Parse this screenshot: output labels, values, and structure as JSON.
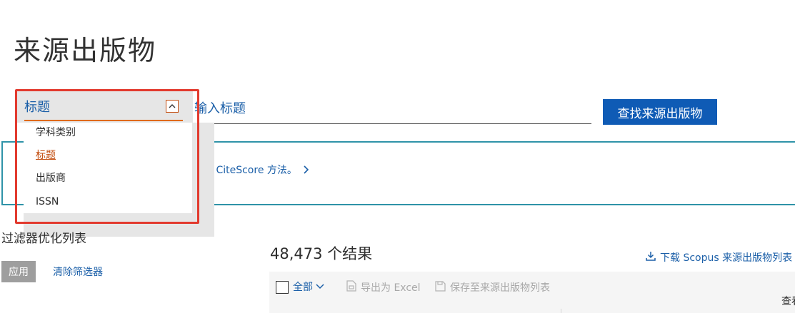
{
  "page": {
    "title": "来源出版物"
  },
  "search": {
    "field_selected": "标题",
    "placeholder": "输入标题",
    "button_label": "查找来源出版物",
    "field_options": [
      {
        "label": "学科类别",
        "selected": false
      },
      {
        "label": "标题",
        "selected": true
      },
      {
        "label": "出版商",
        "selected": false
      },
      {
        "label": "ISSN",
        "selected": false
      }
    ]
  },
  "banner": {
    "link_text": "看 CiteScore 方法。"
  },
  "filters": {
    "heading": "过滤器优化列表",
    "apply_label": "应用",
    "clear_label": "清除筛选器"
  },
  "results": {
    "count_text": "48,473 个结果",
    "download_label": "下载 Scopus 来源出版物列表",
    "select_all_label": "全部",
    "export_label": "导出为 Excel",
    "save_label": "保存至来源出版物列表",
    "view_label": "查看"
  },
  "colors": {
    "accent_blue": "#0f5bb5",
    "link_blue": "#1b5fa8",
    "highlight_red": "#e23a2e",
    "selected_orange": "#c34e10",
    "banner_border": "#2f93a8"
  },
  "icons": {
    "toggle": "chevron-up-icon",
    "banner_link": "chevron-right-icon",
    "download": "download-icon",
    "select_all": "chevron-down-icon",
    "export": "file-excel-icon",
    "save": "save-icon"
  }
}
